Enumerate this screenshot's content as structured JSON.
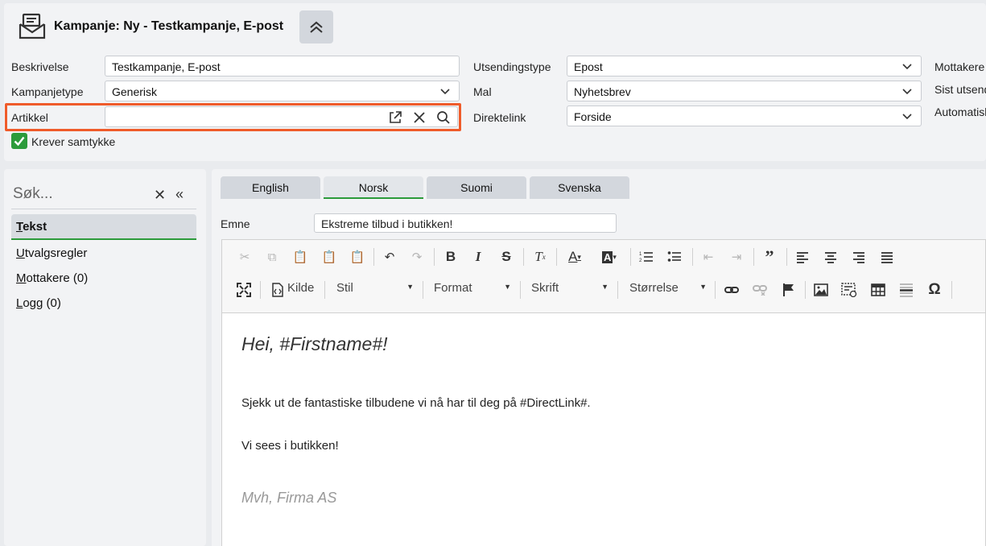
{
  "header": {
    "title": "Kampanje: Ny - Testkampanje, E-post"
  },
  "form": {
    "beskrivelse_label": "Beskrivelse",
    "beskrivelse_value": "Testkampanje, E-post",
    "kampanjetype_label": "Kampanjetype",
    "kampanjetype_value": "Generisk",
    "artikkel_label": "Artikkel",
    "artikkel_value": "",
    "krever_label": "Krever samtykke",
    "krever_checked": true,
    "utsendingstype_label": "Utsendingstype",
    "utsendingstype_value": "Epost",
    "mal_label": "Mal",
    "mal_value": "Nyhetsbrev",
    "direktelink_label": "Direktelink",
    "direktelink_value": "Forside",
    "mottakere_label": "Mottakere",
    "sist_label": "Sist utsend",
    "automatisk_label": "Automatisk"
  },
  "sidebar": {
    "search_placeholder": "Søk...",
    "items": [
      {
        "first": "T",
        "rest": "ekst",
        "active": true
      },
      {
        "first": "U",
        "rest": "tvalgsregler",
        "active": false
      },
      {
        "first": "M",
        "rest": "ottakere (0)",
        "active": false
      },
      {
        "first": "L",
        "rest": "ogg (0)",
        "active": false
      }
    ]
  },
  "tabs": [
    "English",
    "Norsk",
    "Suomi",
    "Svenska"
  ],
  "active_tab": "Norsk",
  "emne": {
    "label": "Emne",
    "value": "Ekstreme tilbud i butikken!"
  },
  "toolbar": {
    "kilde": "Kilde",
    "stil": "Stil",
    "format": "Format",
    "skrift": "Skrift",
    "storrelse": "Størrelse"
  },
  "editor": {
    "greeting": "Hei, #Firstname#!",
    "paragraph1": "Sjekk ut de fantastiske tilbudene vi nå har til deg på #DirectLink#.",
    "paragraph2": "Vi sees i butikken!",
    "signature": "Mvh, Firma AS"
  },
  "colors": {
    "accent_green": "#2c9b3b",
    "highlight_orange": "#ef5b2a"
  }
}
